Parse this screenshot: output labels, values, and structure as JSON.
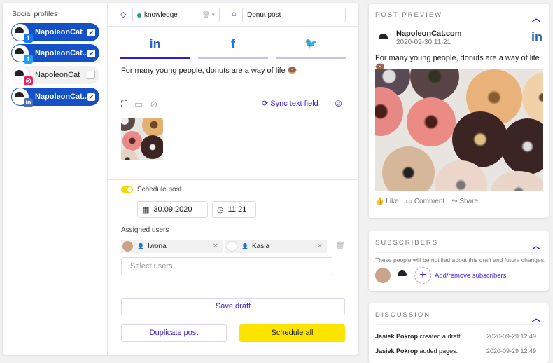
{
  "sidebar": {
    "title": "Social profiles",
    "profiles": [
      {
        "name": "NapoleonCat",
        "network": "facebook",
        "checked": true
      },
      {
        "name": "NapoleonCat....",
        "network": "twitter",
        "checked": true
      },
      {
        "name": "NapoleonCat",
        "network": "instagram",
        "checked": false
      },
      {
        "name": "NapoleonCat....",
        "network": "linkedin",
        "checked": true
      }
    ]
  },
  "editor": {
    "tag_value": "knowledge",
    "post_name": "Donut post",
    "tabs": [
      "in",
      "f",
      "🐦"
    ],
    "post_text": "For many young people, donuts are a way of life 🍩",
    "sync_label": "Sync text field",
    "schedule_label": "Schedule post",
    "date": "30.09.2020",
    "time": "11:21",
    "assigned_label": "Assigned users",
    "users": [
      "Iwona",
      "Kasia"
    ],
    "select_placeholder": "Select users",
    "save_draft": "Save draft",
    "duplicate": "Duplicate post",
    "schedule_all": "Schedule all"
  },
  "preview": {
    "title": "POST PREVIEW",
    "page": "NapoleonCat.com",
    "datetime": "2020-09-30 11:21",
    "network": "in",
    "text": "For many young people, donuts are a way of life 🍩",
    "like": "Like",
    "comment": "Comment",
    "share": "Share"
  },
  "subscribers": {
    "title": "SUBSCRIBERS",
    "note": "These people will be notified about this draft and future changes.",
    "add": "Add/remove subscribers"
  },
  "discussion": {
    "title": "DISCUSSION",
    "entries": [
      {
        "user": "Jasiek Pokrop",
        "action": " created a draft.",
        "time": "2020-09-29 12:49"
      },
      {
        "user": "Jasiek Pokrop",
        "action": " added pages.",
        "time": "2020-09-29 12:49"
      }
    ]
  },
  "colors": {
    "accent": "#3a1fe0",
    "profile": "#1451c8",
    "cta": "#fce300"
  }
}
